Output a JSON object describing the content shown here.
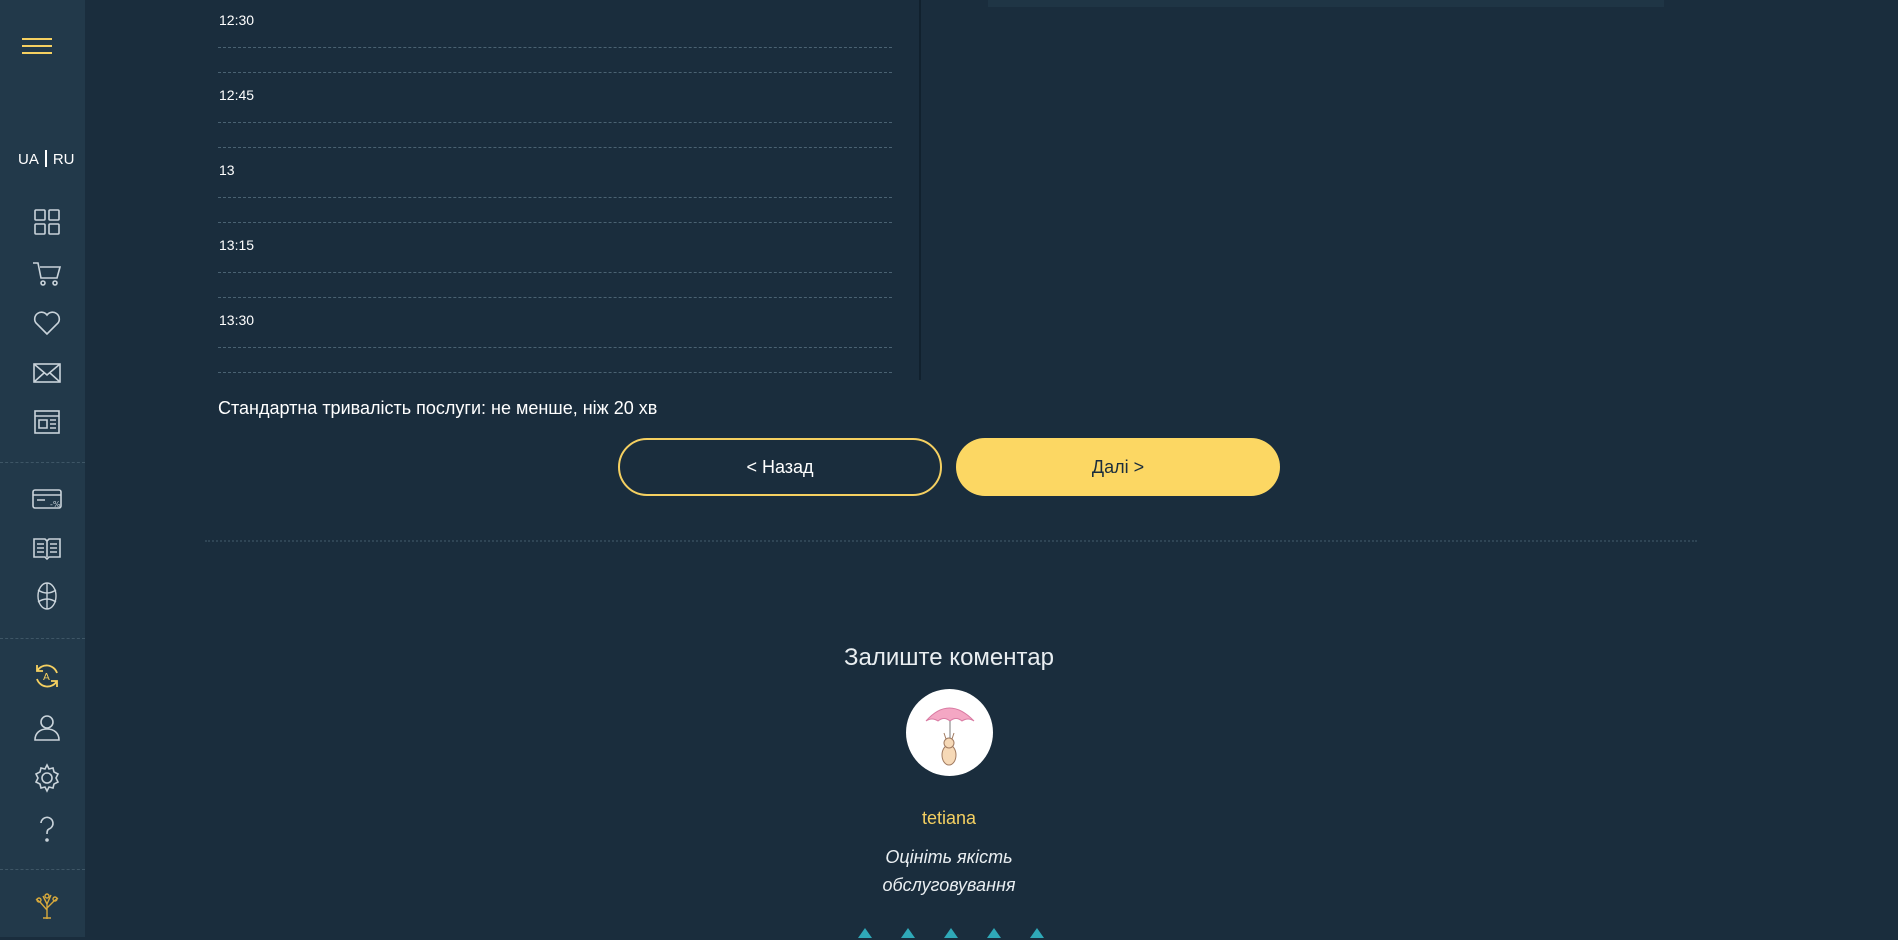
{
  "sidebar": {
    "lang_ua": "UA",
    "lang_ru": "RU",
    "icons": {
      "menu": "hamburger-icon",
      "dashboard": "grid-icon",
      "cart": "cart-icon",
      "favorites": "heart-icon",
      "mail": "envelope-icon",
      "news": "newspaper-icon",
      "discounts": "discount-card-icon",
      "catalog": "book-icon",
      "globe": "globe-icon",
      "sync": "sync-icon",
      "profile": "user-icon",
      "settings": "gear-icon",
      "help": "question-icon",
      "logo": "tree-logo-icon"
    },
    "accent_color": "#f5d061"
  },
  "schedule": {
    "slots": [
      "12:30",
      "12:45",
      "13",
      "13:15",
      "13:30"
    ]
  },
  "duration_text": "Стандартна тривалість послуги: не менше, ніж 20 хв",
  "nav": {
    "back_label": "< Назад",
    "next_label": "Далі   >"
  },
  "comment": {
    "title": "Залиште коментар",
    "username": "tetiana",
    "rate_line1": "Оцініть якість",
    "rate_line2": "обслуговування"
  },
  "colors": {
    "background": "#1a2d3d",
    "sidebar": "#22394a",
    "accent": "#fcd763",
    "star": "#2fa9b8"
  }
}
